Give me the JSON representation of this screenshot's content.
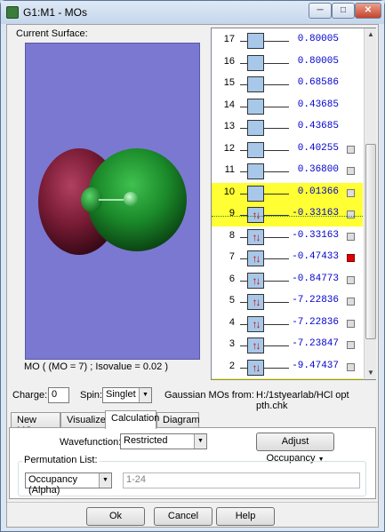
{
  "window": {
    "title": "G1:M1 - MOs",
    "minimize_glyph": "─",
    "maximize_glyph": "□",
    "close_glyph": "✕"
  },
  "surface": {
    "label": "Current Surface:",
    "caption": "MO ( (MO = 7) ; Isovalue = 0.02 )",
    "viewport_color": "#7b78d1"
  },
  "orbitals": [
    {
      "n": "17",
      "energy": "0.80005",
      "occ": "",
      "checkbox": false,
      "checked": false,
      "highlight": false
    },
    {
      "n": "16",
      "energy": "0.80005",
      "occ": "",
      "checkbox": false,
      "checked": false,
      "highlight": false
    },
    {
      "n": "15",
      "energy": "0.68586",
      "occ": "",
      "checkbox": false,
      "checked": false,
      "highlight": false
    },
    {
      "n": "14",
      "energy": "0.43685",
      "occ": "",
      "checkbox": false,
      "checked": false,
      "highlight": false
    },
    {
      "n": "13",
      "energy": "0.43685",
      "occ": "",
      "checkbox": false,
      "checked": false,
      "highlight": false
    },
    {
      "n": "12",
      "energy": "0.40255",
      "occ": "",
      "checkbox": true,
      "checked": false,
      "highlight": false
    },
    {
      "n": "11",
      "energy": "0.36800",
      "occ": "",
      "checkbox": true,
      "checked": false,
      "highlight": false
    },
    {
      "n": "10",
      "energy": "0.01366",
      "occ": "",
      "checkbox": true,
      "checked": false,
      "highlight": true
    },
    {
      "n": "9",
      "energy": "-0.33163",
      "occ": "↑↓",
      "checkbox": true,
      "checked": false,
      "highlight": true
    },
    {
      "n": "8",
      "energy": "-0.33163",
      "occ": "↑↓",
      "checkbox": true,
      "checked": false,
      "highlight": false
    },
    {
      "n": "7",
      "energy": "-0.47433",
      "occ": "↑↓",
      "checkbox": true,
      "checked": true,
      "highlight": false
    },
    {
      "n": "6",
      "energy": "-0.84773",
      "occ": "↑↓",
      "checkbox": true,
      "checked": false,
      "highlight": false
    },
    {
      "n": "5",
      "energy": "-7.22836",
      "occ": "↑↓",
      "checkbox": true,
      "checked": false,
      "highlight": false
    },
    {
      "n": "4",
      "energy": "-7.22836",
      "occ": "↑↓",
      "checkbox": true,
      "checked": false,
      "highlight": false
    },
    {
      "n": "3",
      "energy": "-7.23847",
      "occ": "↑↓",
      "checkbox": true,
      "checked": false,
      "highlight": false
    },
    {
      "n": "2",
      "energy": "-9.47437",
      "occ": "↑↓",
      "checkbox": true,
      "checked": false,
      "highlight": false
    },
    {
      "n": "",
      "energy": "",
      "occ": "↑↓",
      "checkbox": false,
      "checked": false,
      "highlight": true
    }
  ],
  "controls": {
    "charge_label": "Charge:",
    "charge_value": "0",
    "spin_label": "Spin:",
    "spin_value": "Singlet",
    "source_label": "Gaussian MOs from:",
    "source_path": "H:/1styearlab/HCl opt pth.chk"
  },
  "tabs": [
    "New MOs",
    "Visualize",
    "Calculation",
    "Diagram"
  ],
  "active_tab": "Calculation",
  "calculation": {
    "wavefunction_label": "Wavefunction:",
    "wavefunction_value": "Restricted",
    "adjust_label": "Adjust Occupancy",
    "permutation_label": "Permutation List:",
    "occupancy_value": "Occupancy (Alpha)",
    "range_value": "1-24"
  },
  "buttons": {
    "ok": "Ok",
    "cancel": "Cancel",
    "help": "Help"
  },
  "colors": {
    "highlight": "#ffff33",
    "energy": "#0000cc",
    "occupied_arrow": "#cc0000",
    "orbital_box": "#a8c8ea"
  }
}
